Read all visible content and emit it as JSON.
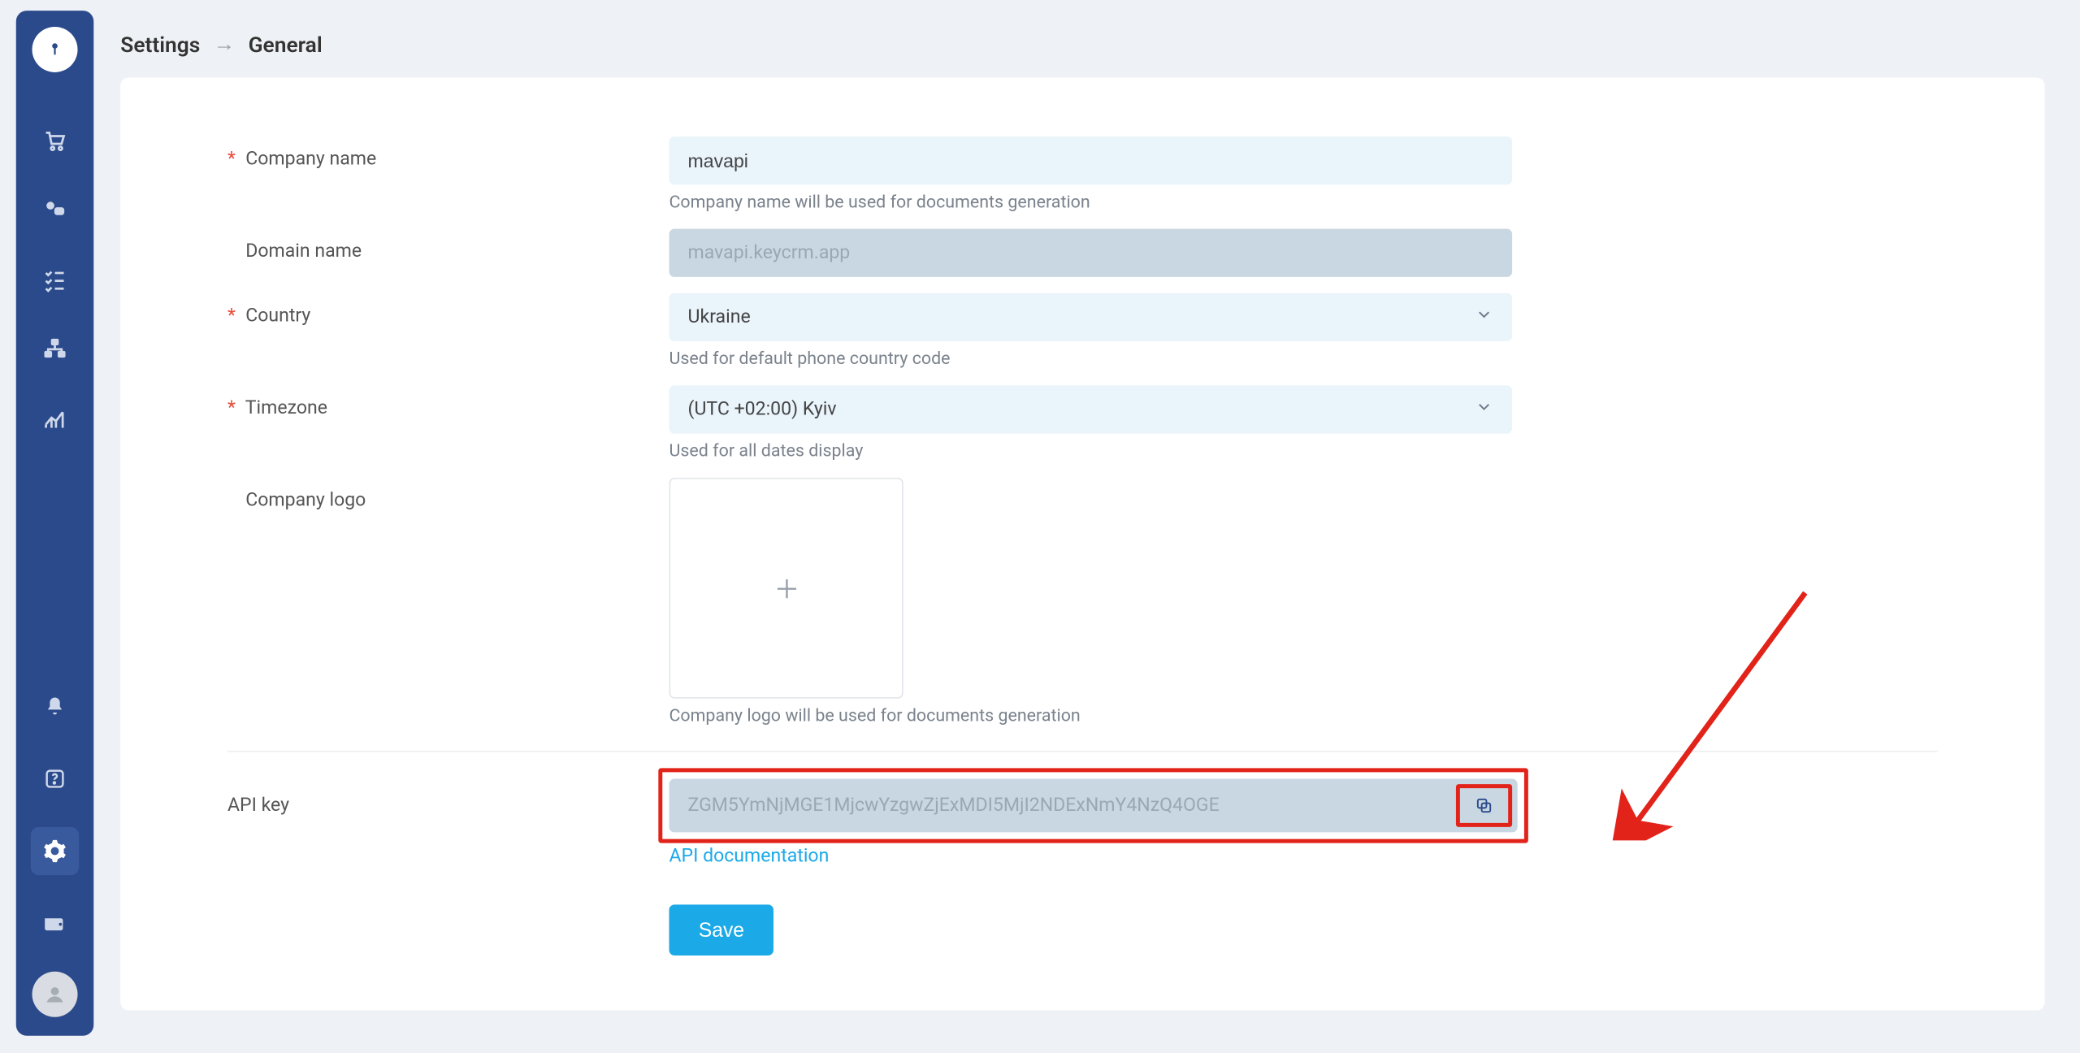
{
  "breadcrumb": {
    "root": "Settings",
    "current": "General"
  },
  "sidebar": {
    "items": [
      "cart",
      "chat",
      "checklist",
      "org",
      "analytics"
    ],
    "bottom": [
      "bell",
      "help",
      "settings",
      "wallet"
    ]
  },
  "form": {
    "company_name": {
      "label": "Company name",
      "value": "mavapi",
      "hint": "Company name will be used for documents generation",
      "required": true
    },
    "domain_name": {
      "label": "Domain name",
      "value": "mavapi.keycrm.app",
      "required": false
    },
    "country": {
      "label": "Country",
      "value": "Ukraine",
      "hint": "Used for default phone country code",
      "required": true
    },
    "timezone": {
      "label": "Timezone",
      "value": "(UTC +02:00) Kyiv",
      "hint": "Used for all dates display",
      "required": true
    },
    "company_logo": {
      "label": "Company logo",
      "hint": "Company logo will be used for documents generation"
    },
    "api_key": {
      "label": "API key",
      "value": "ZGM5YmNjMGE1MjcwYzgwZjExMDI5MjI2NDExNmY4NzQ4OGE",
      "doc_link": "API documentation"
    },
    "save_label": "Save"
  }
}
